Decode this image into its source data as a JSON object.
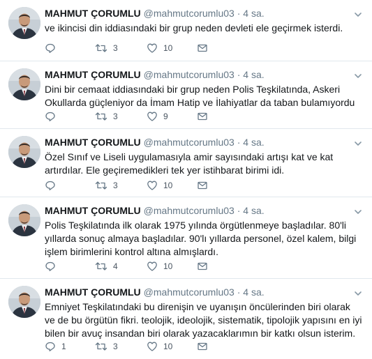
{
  "tweets": [
    {
      "name": "MAHMUT ÇORUMLU",
      "handle": "@mahmutcorumlu03",
      "separator": "·",
      "time": "4 sa.",
      "text": "ve ikincisi din iddiasındaki bir grup neden devleti ele geçirmek isterdi.",
      "replies": "",
      "retweets": "3",
      "likes": "10"
    },
    {
      "name": "MAHMUT ÇORUMLU",
      "handle": "@mahmutcorumlu03",
      "separator": "·",
      "time": "4 sa.",
      "text": "Dini bir cemaat iddiasındaki bir grup neden Polis Teşkilatında, Askeri Okullarda güçleniyor da İmam Hatip ve İlahiyatlar da taban bulamıyordu",
      "replies": "",
      "retweets": "3",
      "likes": "9"
    },
    {
      "name": "MAHMUT ÇORUMLU",
      "handle": "@mahmutcorumlu03",
      "separator": "·",
      "time": "4 sa.",
      "text": "Özel Sınıf ve Liseli uygulamasıyla amir sayısındaki artışı kat ve kat artırdılar. Ele geçiremedikleri tek yer istihbarat birimi idi.",
      "replies": "",
      "retweets": "3",
      "likes": "10"
    },
    {
      "name": "MAHMUT ÇORUMLU",
      "handle": "@mahmutcorumlu03",
      "separator": "·",
      "time": "4 sa.",
      "text": "Polis Teşkilatında ilk olarak 1975 yılında örgütlenmeye başladılar. 80'li yıllarda sonuç almaya başladılar. 90'lı yıllarda personel, özel kalem, bilgi işlem birimlerini kontrol altına almışlardı.",
      "replies": "",
      "retweets": "4",
      "likes": "10"
    },
    {
      "name": "MAHMUT ÇORUMLU",
      "handle": "@mahmutcorumlu03",
      "separator": "·",
      "time": "4 sa.",
      "text": "Emniyet Teşkilatındaki bu direnişin ve uyanışın öncülerinden biri olarak ve de bu örgütün fikri. teolojik, ideolojik, sistematik, tipolojik yapısını en iyi bilen bir avuç insandan biri olarak yazacaklarımın bir katkı olsun isterim.",
      "replies": "1",
      "retweets": "3",
      "likes": "10"
    }
  ],
  "icons": {
    "reply": "reply-icon",
    "retweet": "retweet-icon",
    "like": "heart-icon",
    "message": "envelope-icon",
    "more": "chevron-down-icon"
  },
  "colors": {
    "icon": "#657786",
    "name": "#14171a",
    "secondary": "#657786",
    "divider": "#e1e8ed"
  }
}
